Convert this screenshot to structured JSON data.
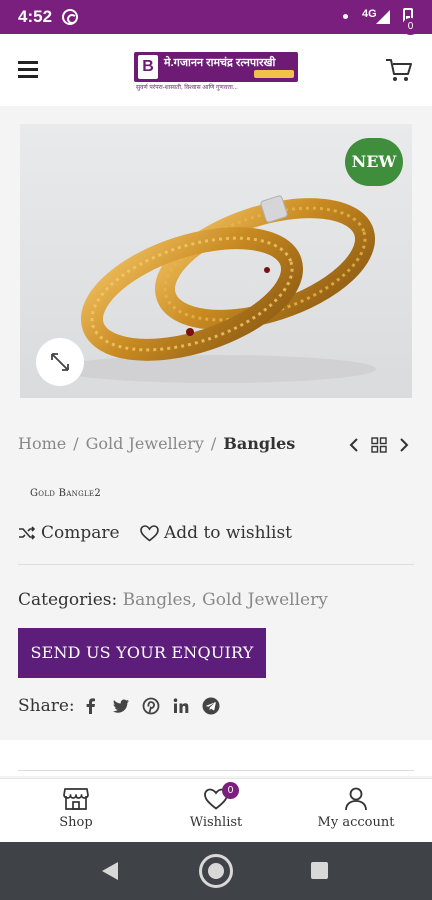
{
  "status_bar": {
    "time": "4:52",
    "network": "4G"
  },
  "header": {
    "logo_name": "मे.गजानन रामचंद्र रत्नपारखी",
    "logo_tagline": "सुवर्ण परंपरा-शास्वती, विश्वास आणि गुणवत्ता...",
    "cart_count": "0"
  },
  "product": {
    "badge": "NEW",
    "sku": "Gold Bangle2"
  },
  "breadcrumb": {
    "items": [
      "Home",
      "Gold Jewellery"
    ],
    "separator": "/",
    "current": "Bangles"
  },
  "actions": {
    "compare": "Compare",
    "wishlist": "Add to wishlist"
  },
  "categories": {
    "label": "Categories:",
    "items": [
      "Bangles",
      "Gold Jewellery"
    ],
    "separator": ",",
    "spacer": " "
  },
  "enquiry_button": "SEND US YOUR ENQUIRY",
  "share": {
    "label": "Share:",
    "icons": [
      "facebook-icon",
      "twitter-icon",
      "pinterest-icon",
      "linkedin-icon",
      "telegram-icon"
    ]
  },
  "bottom_nav": {
    "shop": "Shop",
    "wishlist": "Wishlist",
    "wishlist_count": "0",
    "account": "My account"
  },
  "colors": {
    "brand": "#7b1f7e",
    "button": "#5c1e7a",
    "badge": "#3e8e3b"
  }
}
